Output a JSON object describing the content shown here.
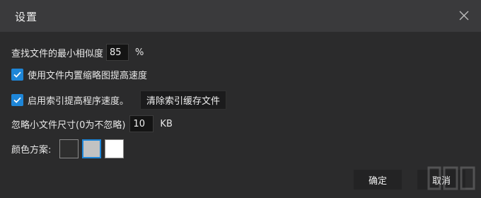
{
  "window": {
    "title": "设置"
  },
  "settings": {
    "similarity_label": "查找文件的最小相似度",
    "similarity_value": "85",
    "similarity_unit": "%",
    "use_thumbnail_label": "使用文件内置缩略图提高速度",
    "use_thumbnail_checked": true,
    "use_index_label": "启用索引提高程序速度。",
    "use_index_checked": true,
    "clear_index_button": "清除索引缓存文件",
    "ignore_small_label": "忽略小文件尺寸(0为不忽略)",
    "ignore_small_value": "10",
    "ignore_small_unit": "KB",
    "color_scheme_label": "颜色方案:",
    "color_schemes": [
      {
        "name": "dark",
        "color": "#2e2e2e"
      },
      {
        "name": "gray",
        "color": "#c2c2c2",
        "selected": true
      },
      {
        "name": "white",
        "color": "#ffffff"
      }
    ]
  },
  "footer": {
    "ok_label": "确定",
    "cancel_label": "取消"
  },
  "colors": {
    "accent": "#1e86d8",
    "title_bar": "#3a3a3c",
    "body": "#2b2b2c"
  },
  "icons": {
    "close": "close-icon",
    "check": "check-icon"
  }
}
